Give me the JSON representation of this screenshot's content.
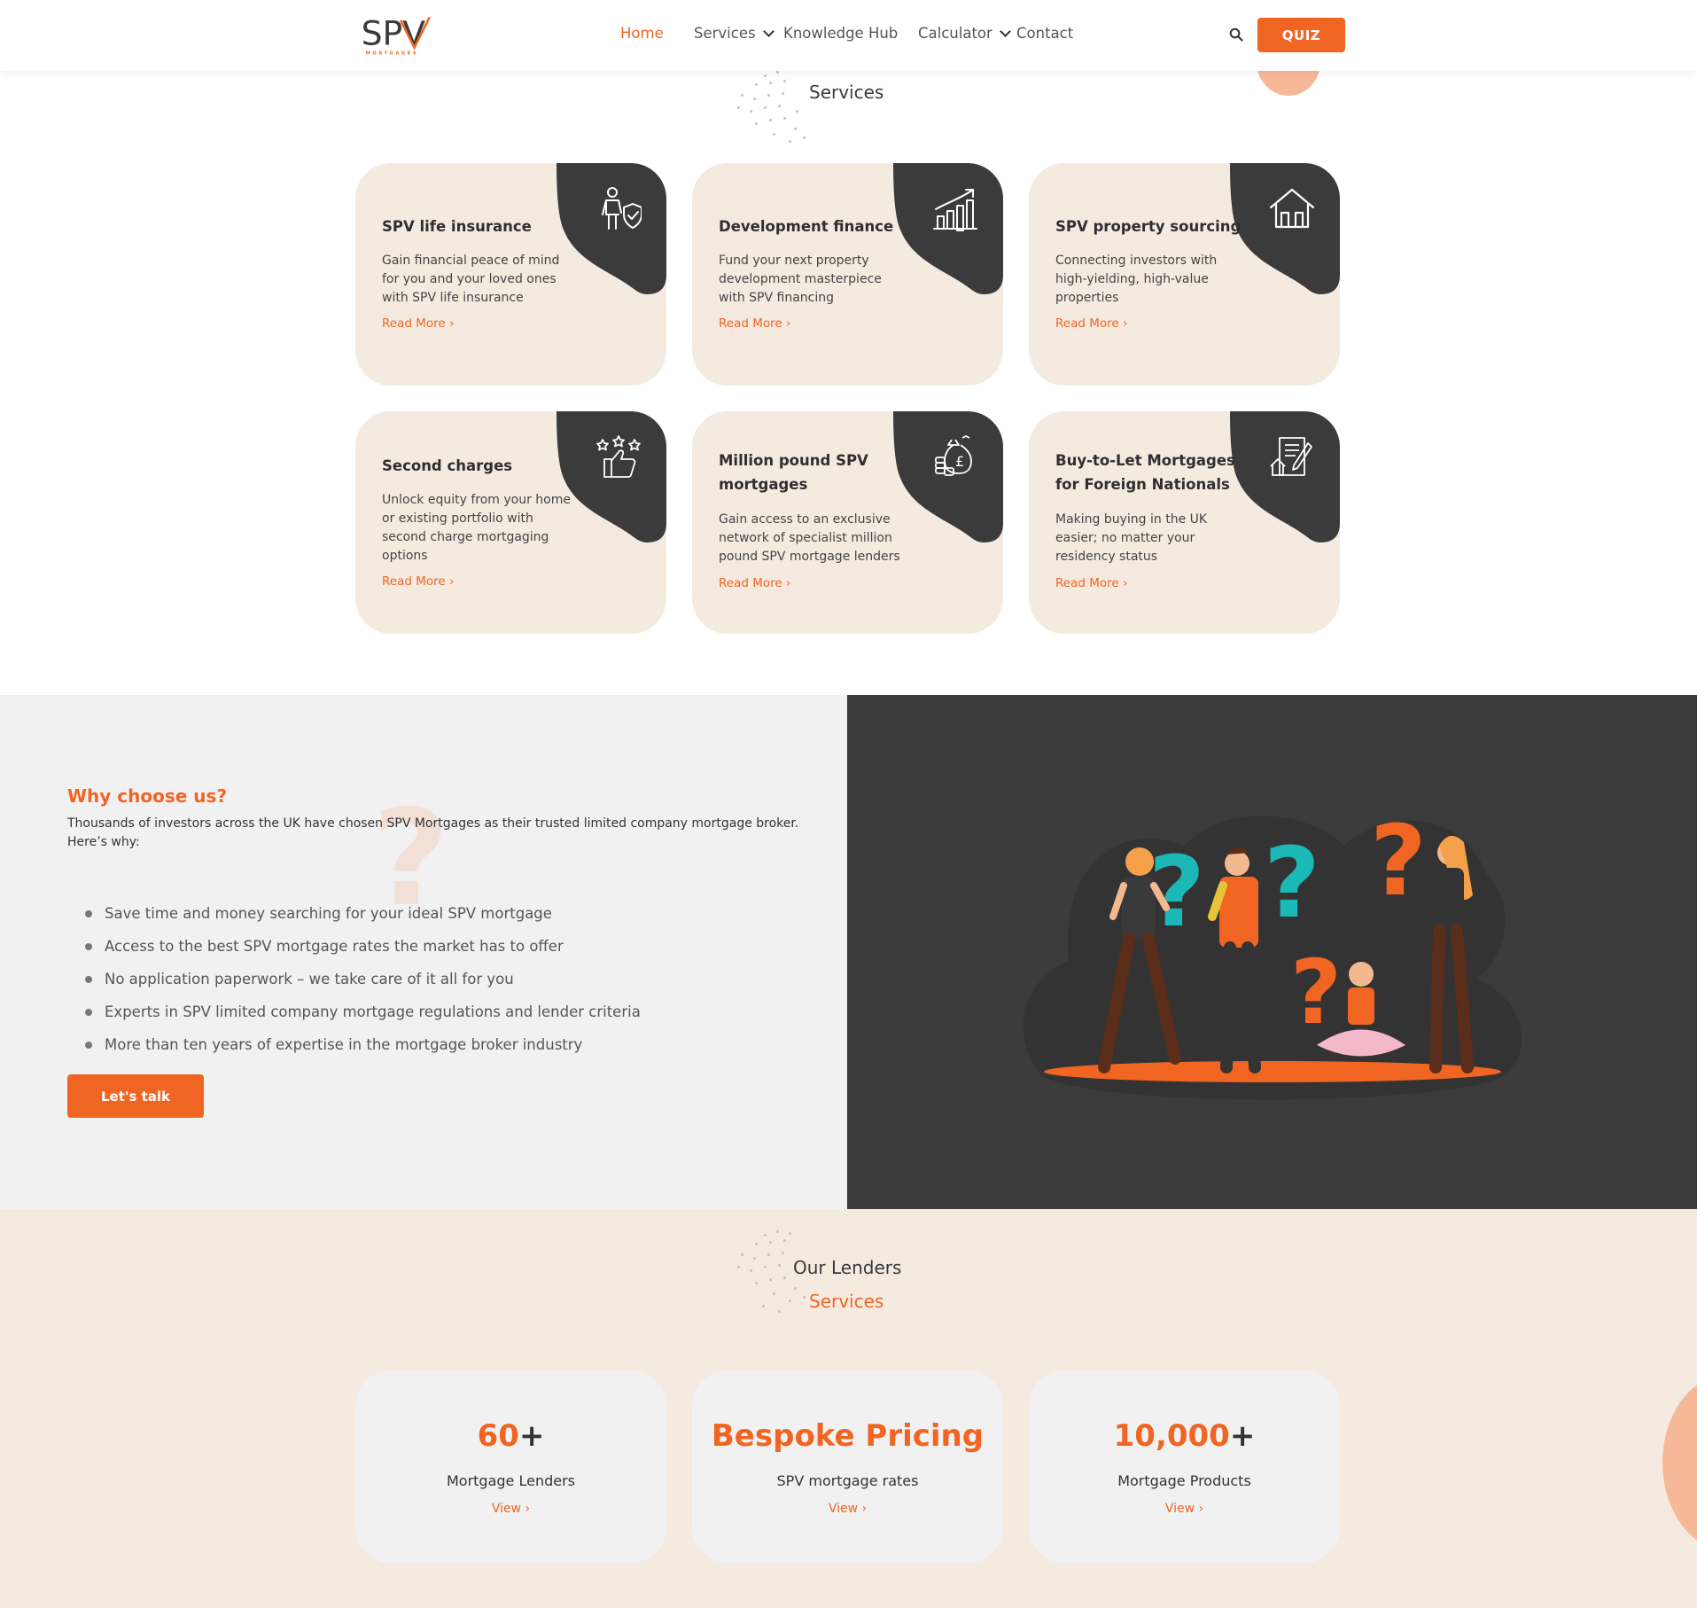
{
  "header": {
    "logo_text": "SPV",
    "logo_sub": "MORTGAGES",
    "nav": [
      {
        "label": "Home",
        "active": true
      },
      {
        "label": "Services",
        "dropdown": true
      },
      {
        "label": "Knowledge Hub"
      },
      {
        "label": "Calculator",
        "dropdown": true
      },
      {
        "label": "Contact"
      }
    ],
    "quiz_label": "QUIZ",
    "search_icon": "search-icon"
  },
  "services": {
    "title": "Services",
    "cards": [
      {
        "title": "SPV life insurance",
        "text": "Gain financial peace of mind for you and your loved ones with SPV life insurance",
        "link": "Read More ›",
        "icon": "person-shield-icon"
      },
      {
        "title": "Development finance",
        "text": "Fund your next property development masterpiece with SPV financing",
        "link": "Read More ›",
        "icon": "growth-chart-icon"
      },
      {
        "title": "SPV property sourcing",
        "text": "Connecting investors with high-yielding, high-value properties",
        "link": "Read More ›",
        "icon": "house-icon"
      },
      {
        "title": "Second charges",
        "text": "Unlock equity from your home or existing portfolio with second charge mortgaging options",
        "link": "Read More ›",
        "icon": "thumbs-up-stars-icon"
      },
      {
        "title": "Million pound SPV mortgages",
        "text": "Gain access to an exclusive network of specialist million pound SPV mortgage lenders",
        "link": "Read More ›",
        "icon": "money-bag-icon"
      },
      {
        "title": "Buy-to-Let Mortgages for Foreign Nationals",
        "text": "Making buying in the UK easier; no matter your residency status",
        "link": "Read More ›",
        "icon": "contract-house-icon"
      }
    ]
  },
  "why": {
    "title": "Why choose us?",
    "intro": "Thousands of investors across the UK have chosen SPV Mortgages as their trusted limited company mortgage broker. Here’s why:",
    "bullets": [
      "Save time and money searching for your ideal SPV mortgage",
      "Access to the best SPV mortgage rates the market has to offer",
      "No application paperwork – we take care of it all for you",
      "Experts in SPV limited company mortgage regulations and lender criteria",
      "More than ten years of expertise in the mortgage broker industry"
    ],
    "button": "Let's talk"
  },
  "lenders": {
    "title": "Our Lenders",
    "subtitle": "Services",
    "stats": [
      {
        "num": "60",
        "suffix": "+",
        "label": "Mortgage Lenders",
        "link": "View ›"
      },
      {
        "num": "Bespoke Pricing",
        "suffix": "",
        "label": "SPV mortgage rates",
        "link": "View ›"
      },
      {
        "num": "10,000",
        "suffix": "+",
        "label": "Mortgage Products",
        "link": "View ›"
      }
    ]
  },
  "colors": {
    "accent": "#f16522",
    "dark": "#3b3b3b",
    "cream": "#f5eae0",
    "light": "#f1f1f2"
  }
}
